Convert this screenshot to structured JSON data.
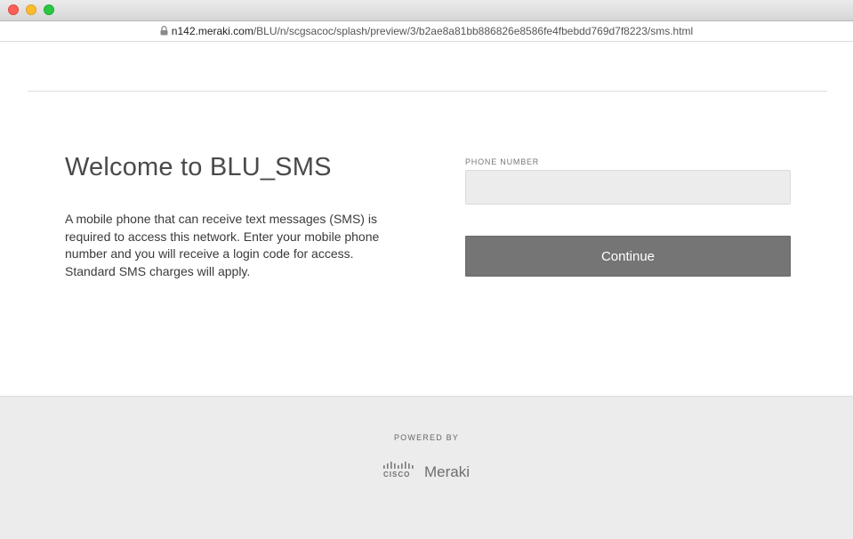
{
  "browser": {
    "url_host": "n142.meraki.com",
    "url_path": "/BLU/n/scgsacoc/splash/preview/3/b2ae8a81bb886826e8586fe4fbebdd769d7f8223/sms.html",
    "lock_icon": "lock-icon"
  },
  "page": {
    "title": "Welcome to BLU_SMS",
    "description": "A mobile phone that can receive text messages (SMS) is required to access this network. Enter your mobile phone number and you will receive a login code for access. Standard SMS charges will apply."
  },
  "form": {
    "phone_label": "PHONE NUMBER",
    "phone_value": "",
    "phone_placeholder": "",
    "continue_label": "Continue",
    "button_color": "#757575"
  },
  "footer": {
    "powered_by": "POWERED BY",
    "cisco_text": "CISCO",
    "meraki_text": "Meraki"
  }
}
